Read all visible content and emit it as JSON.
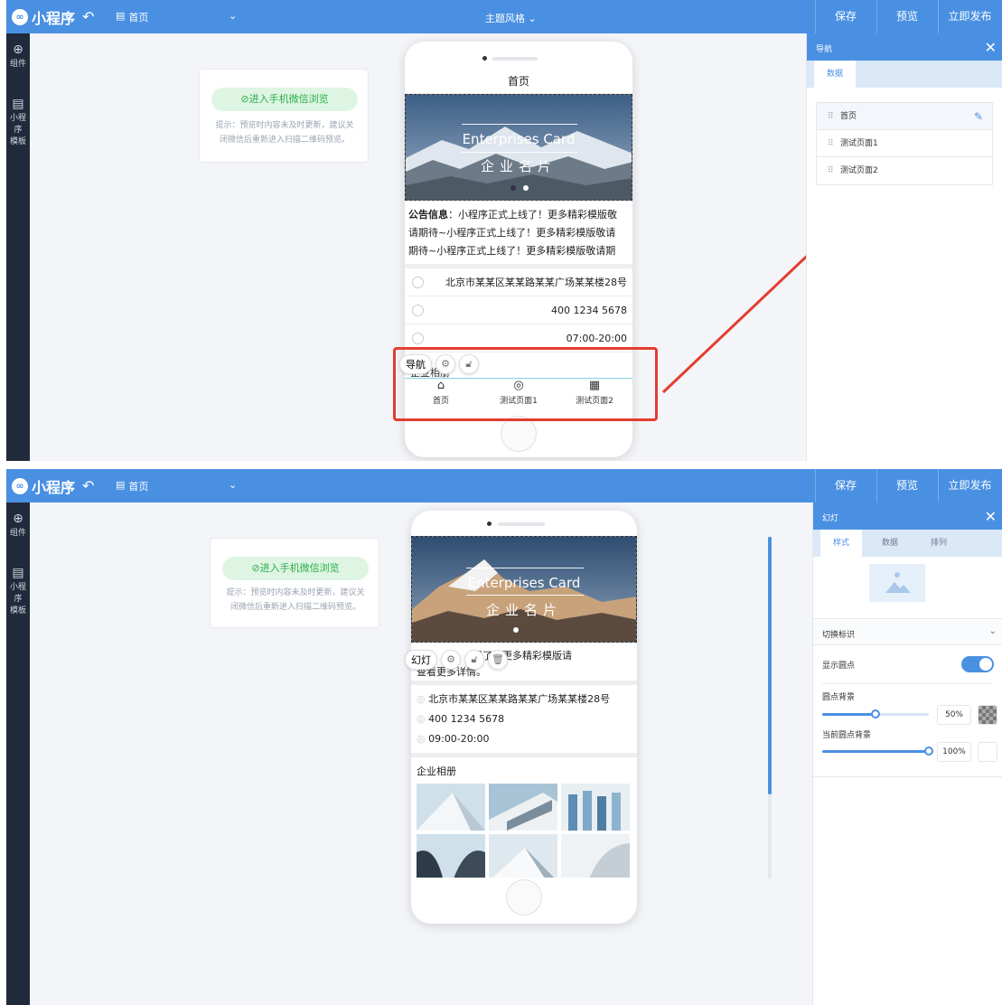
{
  "app": {
    "logo_text": "小程序",
    "page_selector": "首页",
    "theme": "主题风格",
    "buttons": {
      "save": "保存",
      "preview": "预览",
      "publish": "立即发布"
    }
  },
  "leftbar": {
    "components": "组件",
    "templates_line1": "小程序",
    "templates_line2": "模板"
  },
  "preview_card": {
    "button_label": "进入手机微信浏览",
    "tip_line1": "提示：预览时内容未及时更新，建议关",
    "tip_line2": "闭微信后重新进入扫描二维码预览。"
  },
  "phone": {
    "page_title": "首页",
    "banner": {
      "en": "Enterprises Card",
      "zh": "企业名片"
    },
    "notice_label": "公告信息",
    "notice_line1": "：小程序正式上线了！更多精彩模版敬",
    "notice_line2": "请期待~小程序正式上线了！更多精彩模版敬请",
    "notice_line3": "期待~小程序正式上线了！更多精彩模版敬请期",
    "address": "北京市某某区某某路某某广场某某楼28号",
    "phone": "400 1234 5678",
    "hours1": "07:00-20:00",
    "hours2": "09:00-20:00",
    "album_title": "企业相册",
    "album_partial": "企业相册",
    "notice_partial": "线了！更多精彩模版请",
    "notice_partial2": "查看更多详情。",
    "tabs": [
      "首页",
      "测试页面1",
      "测试页面2"
    ]
  },
  "floatbar": {
    "nav": "导航",
    "slide": "幻灯"
  },
  "nav_panel": {
    "title": "导航",
    "tab_data": "数据",
    "items": [
      "首页",
      "测试页面1",
      "测试页面2"
    ]
  },
  "slide_panel": {
    "title": "幻灯",
    "tabs": [
      "样式",
      "数据",
      "排列"
    ],
    "section": "切换标识",
    "show_dots": "显示圆点",
    "show_dots_on": true,
    "dot_bg": "圆点背景",
    "dot_bg_value": "50%",
    "dot_bg_level": 0.5,
    "current_dot_bg": "当前圆点背景",
    "current_dot_bg_value": "100%",
    "current_dot_bg_level": 1.0
  },
  "colors": {
    "accent": "#4a90e2",
    "sidebar": "#1f2b3a",
    "green": "#2aae4c",
    "annotation": "#e43d2f"
  }
}
